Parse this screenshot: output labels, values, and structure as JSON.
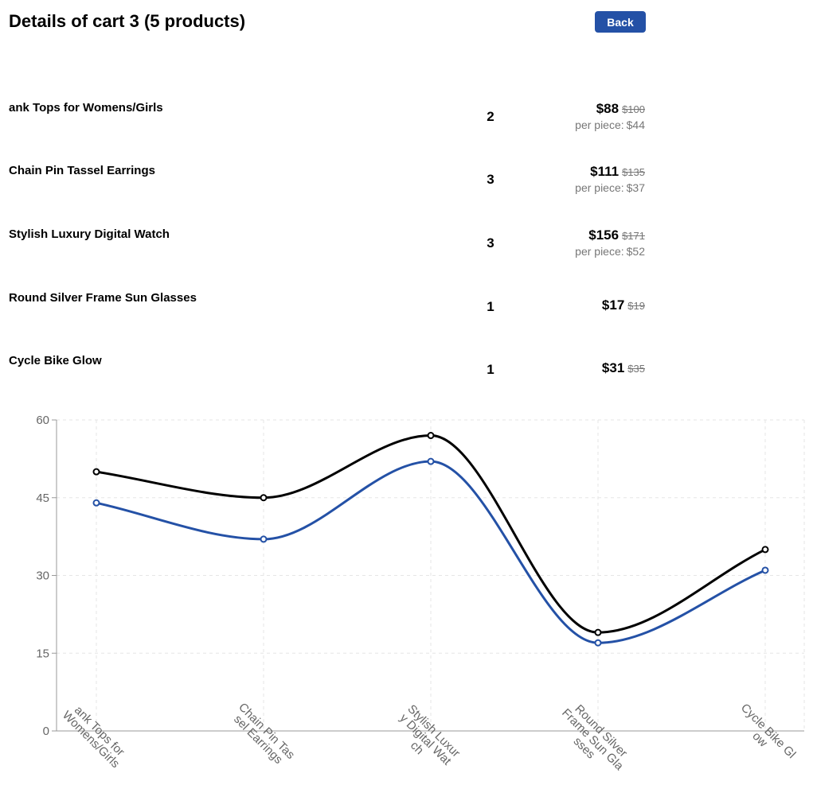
{
  "header": {
    "title": "Details of cart 3 (5 products)",
    "back_label": "Back"
  },
  "products": [
    {
      "name": "ank Tops for Womens/Girls",
      "quantity": "2",
      "price": "$88",
      "original_price": "$100",
      "per_piece_label": "per piece:",
      "per_piece_value": "$44"
    },
    {
      "name": "Chain Pin Tassel Earrings",
      "quantity": "3",
      "price": "$111",
      "original_price": "$135",
      "per_piece_label": "per piece:",
      "per_piece_value": "$37"
    },
    {
      "name": "Stylish Luxury Digital Watch",
      "quantity": "3",
      "price": "$156",
      "original_price": "$171",
      "per_piece_label": "per piece:",
      "per_piece_value": "$52"
    },
    {
      "name": "Round Silver Frame Sun Glasses",
      "quantity": "1",
      "price": "$17",
      "original_price": "$19",
      "per_piece_label": "",
      "per_piece_value": ""
    },
    {
      "name": "Cycle Bike Glow",
      "quantity": "1",
      "price": "$31",
      "original_price": "$35",
      "per_piece_label": "",
      "per_piece_value": ""
    }
  ],
  "chart_data": {
    "type": "line",
    "title": "",
    "xlabel": "",
    "ylabel": "",
    "ylim": [
      0,
      60
    ],
    "yticks": [
      "0",
      "15",
      "30",
      "45",
      "60"
    ],
    "grid": true,
    "curve": "smooth",
    "categories": [
      [
        "ank Tops for",
        "Womens/Girls"
      ],
      [
        "Chain Pin Tas",
        "sel Earrings"
      ],
      [
        "Stylish Luxur",
        "y Digital Wat",
        "ch"
      ],
      [
        "Round Silver",
        "Frame Sun Gla",
        "sses"
      ],
      [
        "Cycle Bike Gl",
        "ow"
      ]
    ],
    "series": [
      {
        "color": "#000000",
        "values": [
          50,
          45,
          57,
          19,
          35
        ]
      },
      {
        "color": "#2451a6",
        "values": [
          44,
          37,
          52,
          17,
          31
        ]
      }
    ]
  }
}
